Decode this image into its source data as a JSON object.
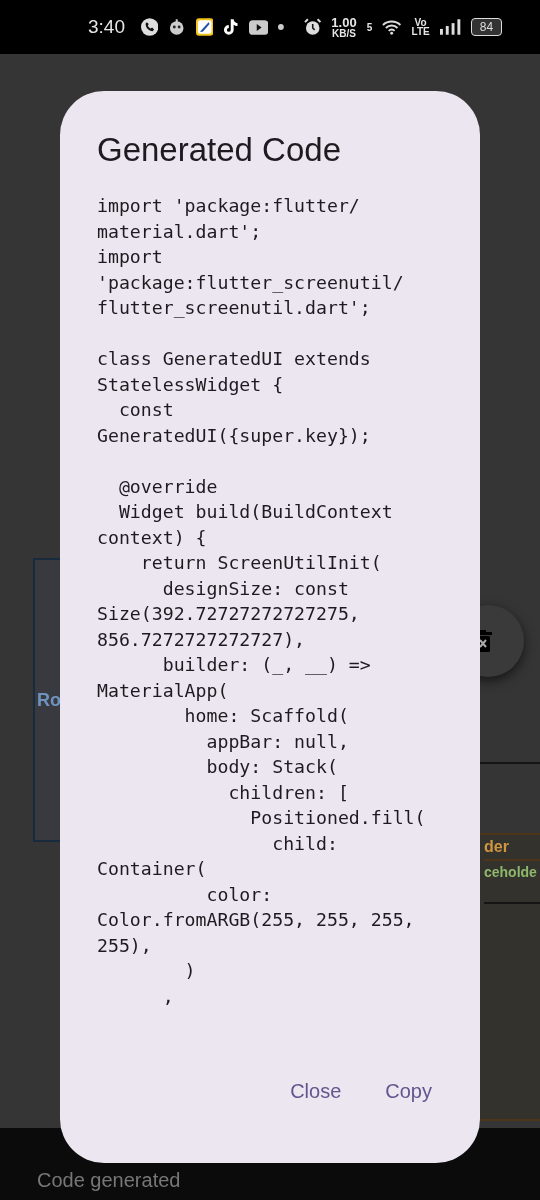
{
  "status_bar": {
    "time": "3:40",
    "net_speed": "1.00",
    "net_unit": "KB/S",
    "wifi_band": "5",
    "volte_top": "Vo",
    "volte_bottom": "LTE",
    "battery": "84"
  },
  "background": {
    "box_text": "Ro",
    "field_label": "der",
    "field_text": "ceholde",
    "snackbar": "Code generated"
  },
  "dialog": {
    "title": "Generated Code",
    "code": "import 'package:flutter/\nmaterial.dart';\nimport\n'package:flutter_screenutil/\nflutter_screenutil.dart';\n\nclass GeneratedUI extends\nStatelessWidget {\n  const\nGeneratedUI({super.key});\n\n  @override\n  Widget build(BuildContext\ncontext) {\n    return ScreenUtilInit(\n      designSize: const\nSize(392.72727272727275,\n856.7272727272727),\n      builder: (_, __) =>\nMaterialApp(\n        home: Scaffold(\n          appBar: null,\n          body: Stack(\n            children: [\n              Positioned.fill(\n                child:\nContainer(\n          color:\nColor.fromARGB(255, 255, 255,\n255),\n        )\n      ,",
    "buttons": [
      "Close",
      "Copy"
    ]
  }
}
